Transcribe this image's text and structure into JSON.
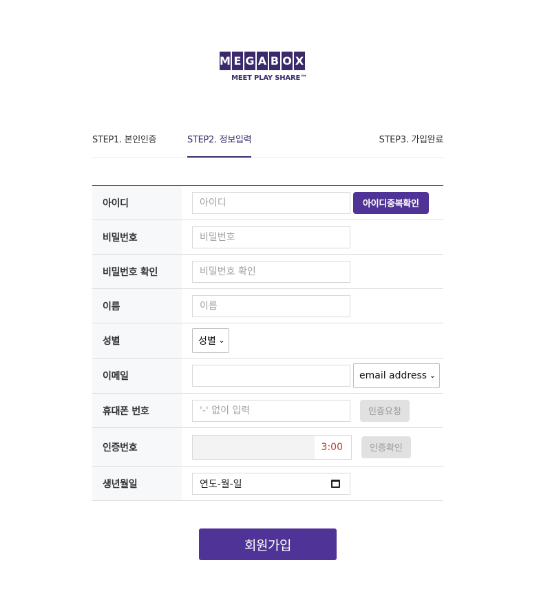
{
  "logo": {
    "letters": [
      "M",
      "E",
      "G",
      "A",
      "B",
      "O",
      "X"
    ],
    "tagline": "MEET PLAY SHARE™"
  },
  "steps": [
    {
      "label": "STEP1. 본인인증"
    },
    {
      "label": "STEP2. 정보입력"
    },
    {
      "label": "STEP3. 가입완료"
    }
  ],
  "form": {
    "id": {
      "label": "아이디",
      "placeholder": "아이디",
      "button": "아이디중복확인"
    },
    "password": {
      "label": "비밀번호",
      "placeholder": "비밀번호"
    },
    "password_confirm": {
      "label": "비밀번호 확인",
      "placeholder": "비밀번호 확인"
    },
    "name": {
      "label": "이름",
      "placeholder": "이름"
    },
    "gender": {
      "label": "성별",
      "selected": "성별"
    },
    "email": {
      "label": "이메일",
      "value": "",
      "domain_selected": "email address"
    },
    "phone": {
      "label": "휴대폰 번호",
      "placeholder": "'-' 없이 입력",
      "button": "인증요청"
    },
    "auth_code": {
      "label": "인증번호",
      "timer": "3:00",
      "button": "인증확인"
    },
    "birth": {
      "label": "생년월일",
      "value": "연도-월-일"
    }
  },
  "submit_label": "회원가입",
  "colors": {
    "brand": "#503396",
    "logo": "#3b2a6b",
    "timer": "#c0392b"
  }
}
